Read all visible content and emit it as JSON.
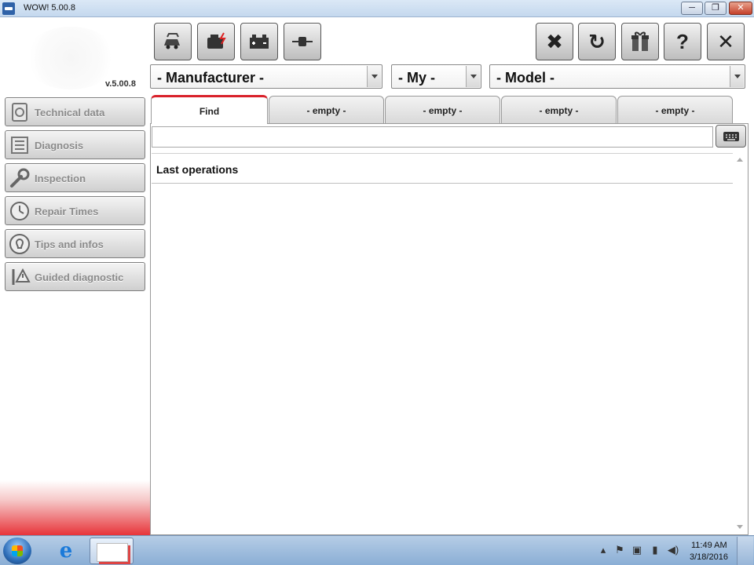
{
  "window": {
    "title": "WOW! 5.00.8",
    "min_glyph": "─",
    "max_glyph": "❐",
    "close_glyph": "✕"
  },
  "sidebar": {
    "version": "v.5.00.8",
    "items": [
      {
        "label": "Technical data",
        "icon": "car-manual-icon"
      },
      {
        "label": "Diagnosis",
        "icon": "ecu-diagnosis-icon"
      },
      {
        "label": "Inspection",
        "icon": "wrench-icon"
      },
      {
        "label": "Repair Times",
        "icon": "clock-icon"
      },
      {
        "label": "Tips and infos",
        "icon": "lightbulb-icon"
      },
      {
        "label": "Guided diagnostic",
        "icon": "warning-probe-icon"
      }
    ]
  },
  "toolbar": {
    "left": [
      {
        "name": "vehicles-button",
        "icon": "car-stack-icon"
      },
      {
        "name": "engine-button",
        "icon": "engine-icon"
      },
      {
        "name": "battery-button",
        "icon": "battery-icon"
      },
      {
        "name": "connector-button",
        "icon": "plug-icon"
      }
    ],
    "right": [
      {
        "name": "settings-tools-button",
        "icon": "tools-icon",
        "glyph": "✖"
      },
      {
        "name": "update-button",
        "icon": "refresh-icon",
        "glyph": "↻"
      },
      {
        "name": "gift-button",
        "icon": "gift-icon",
        "glyph": "🎁"
      },
      {
        "name": "help-button",
        "icon": "help-icon",
        "glyph": "?"
      },
      {
        "name": "close-app-button",
        "icon": "close-icon",
        "glyph": "✕"
      }
    ]
  },
  "selectors": {
    "manufacturer": "- Manufacturer -",
    "my": "- My -",
    "model": "- Model -"
  },
  "tabs": [
    {
      "label": "Find"
    },
    {
      "label": "-  empty  -"
    },
    {
      "label": "-  empty  -"
    },
    {
      "label": "-  empty  -"
    },
    {
      "label": "-  empty  -"
    }
  ],
  "search": {
    "value": "",
    "placeholder": ""
  },
  "last_operations": {
    "title": "Last operations"
  },
  "taskbar": {
    "time": "11:49 AM",
    "date": "3/18/2016"
  }
}
